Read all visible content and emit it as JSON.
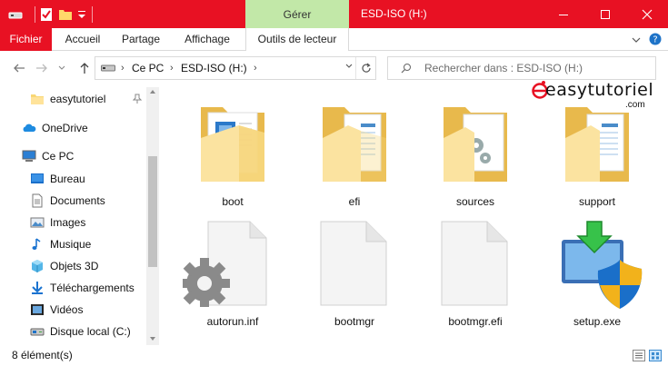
{
  "window": {
    "title": "ESD-ISO (H:)",
    "context_tab": "Gérer",
    "accent_color": "#e81123",
    "context_color": "#c2e8a8"
  },
  "ribbon": {
    "tabs": [
      "Fichier",
      "Accueil",
      "Partage",
      "Affichage",
      "Outils de lecteur"
    ]
  },
  "address": {
    "crumbs": [
      "Ce PC",
      "ESD-ISO (H:)"
    ]
  },
  "search": {
    "placeholder": "Rechercher dans : ESD-ISO (H:)"
  },
  "watermark": {
    "text": "easytutoriel",
    "suffix": ".com"
  },
  "nav": {
    "items": [
      {
        "label": "easytutoriel",
        "icon": "folder-icon"
      },
      {
        "label": "OneDrive",
        "icon": "cloud-icon"
      },
      {
        "label": "Ce PC",
        "icon": "computer-icon"
      },
      {
        "label": "Bureau",
        "icon": "desktop-icon"
      },
      {
        "label": "Documents",
        "icon": "documents-icon"
      },
      {
        "label": "Images",
        "icon": "images-icon"
      },
      {
        "label": "Musique",
        "icon": "music-icon"
      },
      {
        "label": "Objets 3D",
        "icon": "cube-3d-icon"
      },
      {
        "label": "Téléchargements",
        "icon": "download-icon"
      },
      {
        "label": "Vidéos",
        "icon": "video-icon"
      },
      {
        "label": "Disque local (C:)",
        "icon": "drive-icon"
      }
    ]
  },
  "files": [
    {
      "name": "boot",
      "icon": "folder-icon"
    },
    {
      "name": "efi",
      "icon": "folder-icon"
    },
    {
      "name": "sources",
      "icon": "folder-icon"
    },
    {
      "name": "support",
      "icon": "folder-icon"
    },
    {
      "name": "autorun.inf",
      "icon": "settings-file-icon"
    },
    {
      "name": "bootmgr",
      "icon": "blank-file-icon"
    },
    {
      "name": "bootmgr.efi",
      "icon": "blank-file-icon"
    },
    {
      "name": "setup.exe",
      "icon": "setup-installer-icon"
    }
  ],
  "status": {
    "count": "8 élément(s)"
  }
}
